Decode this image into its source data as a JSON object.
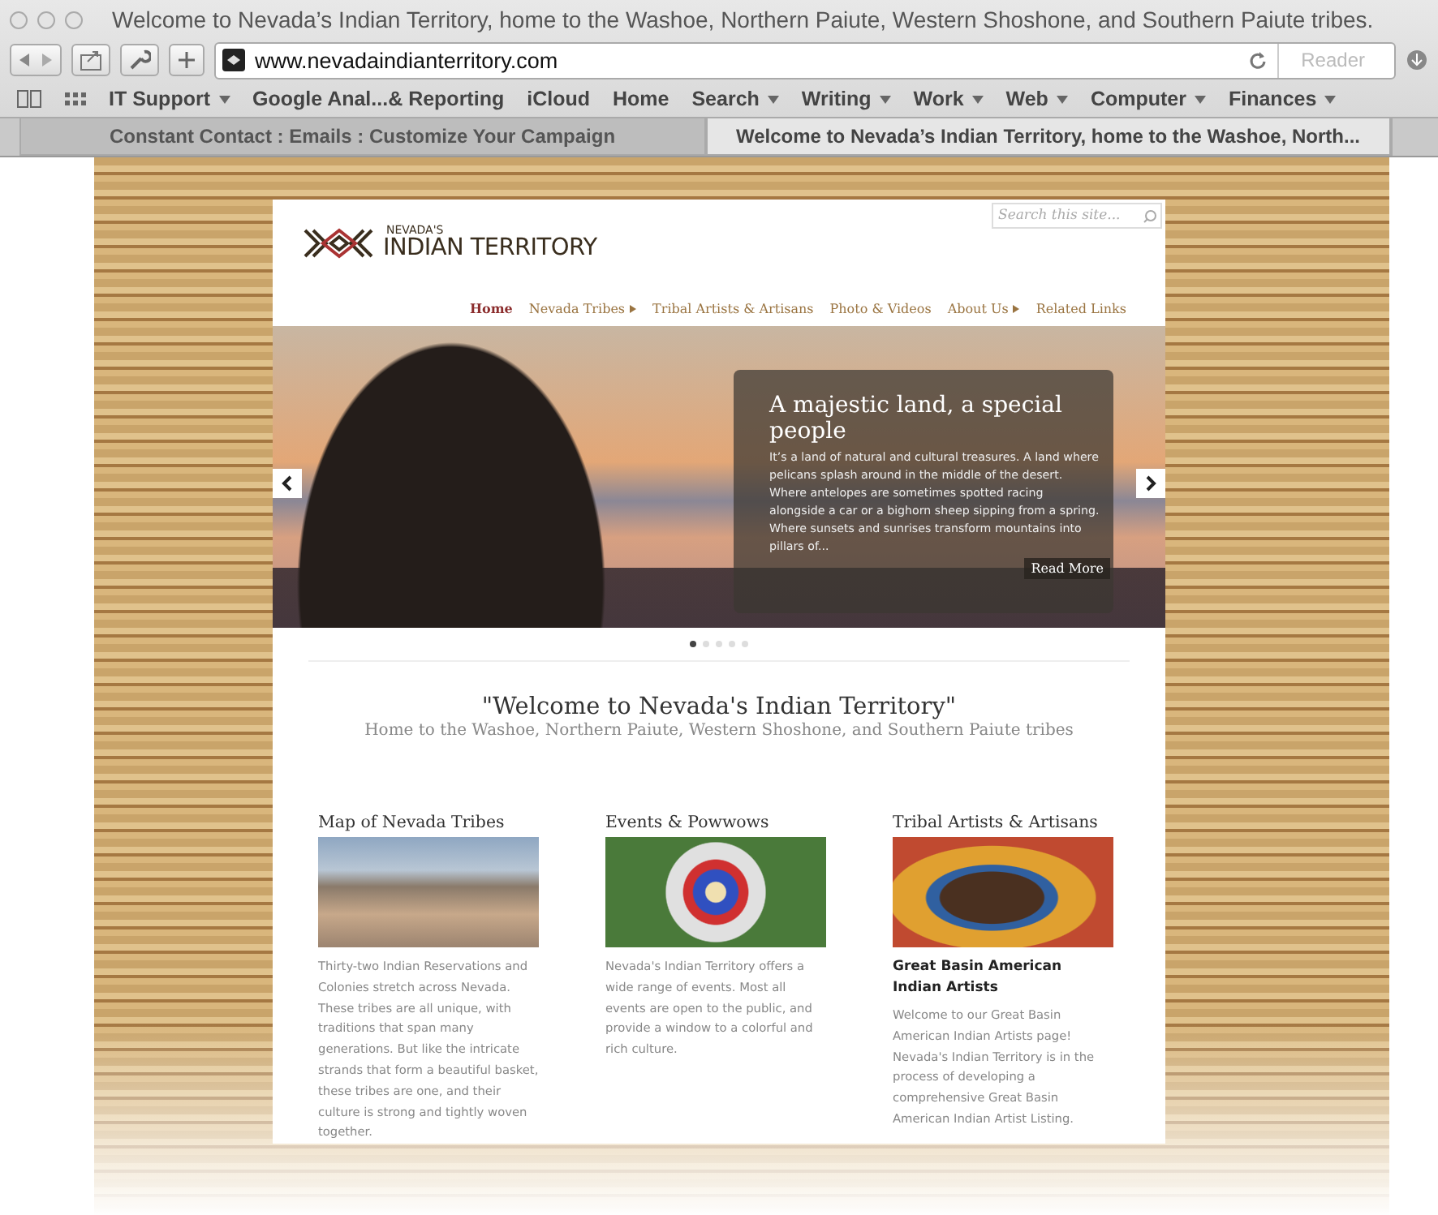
{
  "window": {
    "title": "Welcome to Nevada’s Indian Territory, home to the Washoe, Northern Paiute, Western Shoshone, and Southern Paiute tribes."
  },
  "toolbar": {
    "url": "www.nevadaindianterritory.com",
    "reader": "Reader"
  },
  "bookmarks": [
    {
      "label": "IT Support",
      "menu": true
    },
    {
      "label": "Google Anal...& Reporting",
      "menu": false
    },
    {
      "label": "iCloud",
      "menu": false
    },
    {
      "label": "Home",
      "menu": false
    },
    {
      "label": "Search",
      "menu": true
    },
    {
      "label": "Writing",
      "menu": true
    },
    {
      "label": "Work",
      "menu": true
    },
    {
      "label": "Web",
      "menu": true
    },
    {
      "label": "Computer",
      "menu": true
    },
    {
      "label": "Finances",
      "menu": true
    }
  ],
  "tabs": [
    {
      "label": "Constant Contact : Emails : Customize Your Campaign",
      "selected": false
    },
    {
      "label": "Welcome to Nevada’s Indian Territory, home to the Washoe, North...",
      "selected": true
    }
  ],
  "site": {
    "logo": {
      "small": "NEVADA'S",
      "large": "INDIAN TERRITORY"
    },
    "search": {
      "placeholder": "Search this site..."
    },
    "nav": [
      {
        "label": "Home",
        "selected": true,
        "submenu": false
      },
      {
        "label": "Nevada Tribes",
        "selected": false,
        "submenu": true
      },
      {
        "label": "Tribal Artists & Artisans",
        "selected": false,
        "submenu": false
      },
      {
        "label": "Photo & Videos",
        "selected": false,
        "submenu": false
      },
      {
        "label": "About Us",
        "selected": false,
        "submenu": true
      },
      {
        "label": "Related Links",
        "selected": false,
        "submenu": false
      }
    ],
    "slider": {
      "title": "A majestic land, a special people",
      "text": "It’s a land of natural and cultural treasures. A land where pelicans splash around in the middle of the desert. Where antelopes are sometimes spotted racing alongside a car or a bighorn sheep sipping from a spring. Where sunsets and sunrises transform mountains into pillars of...",
      "read_more": "Read More",
      "dots": [
        {
          "selected": true
        },
        {
          "selected": false
        },
        {
          "selected": false
        },
        {
          "selected": false
        },
        {
          "selected": false
        }
      ]
    },
    "welcome": {
      "title": "\"Welcome to Nevada's Indian Territory\"",
      "subtitle": "Home to the Washoe, Northern Paiute, Western Shoshone, and Southern Paiute tribes"
    },
    "columns": [
      {
        "heading": "Map of Nevada Tribes",
        "kind": "landscape",
        "text": "Thirty-two Indian Reservations and Colonies stretch across Nevada. These tribes are all unique, with traditions that span many generations. But like the intricate strands that form a beautiful basket, these tribes are one, and their culture is strong and tightly woven together."
      },
      {
        "heading": "Events & Powwows",
        "kind": "headdress",
        "text": "Nevada's Indian Territory offers a wide range of events. Most all events are open to the public, and provide a window to a colorful and rich culture."
      },
      {
        "heading": "Tribal Artists & Artisans",
        "kind": "bison",
        "subheading": "Great Basin American Indian Artists",
        "text": "Welcome to our Great Basin American Indian Artists page! Nevada's Indian Territory is in the process of developing a comprehensive Great Basin American Indian Artist Listing."
      }
    ]
  }
}
